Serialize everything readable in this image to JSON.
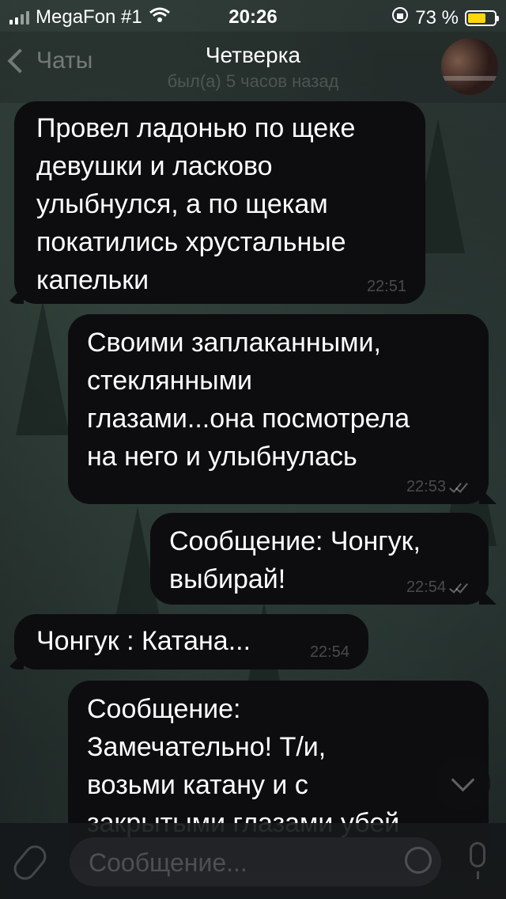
{
  "status_bar": {
    "carrier": "MegaFon #1",
    "time": "20:26",
    "battery_text": "73 %",
    "battery_level": 0.73,
    "battery_color": "#ffd60a"
  },
  "nav": {
    "back_label": "Чаты",
    "title": "Четверка",
    "subtitle": "был(а) 5 часов назад"
  },
  "messages": [
    {
      "direction": "in",
      "text": "Провел ладонью по щеке\nдевушки и ласково\nулыбнулся, а по щекам\nпокатились хрустальные\nкапельки",
      "time": "22:51"
    },
    {
      "direction": "out",
      "text": "Своими заплаканными,\nстеклянными\nглазами...она посмотрела\nна него и улыбнулась",
      "time": "22:53"
    },
    {
      "direction": "out",
      "text": "Сообщение: Чонгук,\nвыбирай!",
      "time": "22:54"
    },
    {
      "direction": "in",
      "text": "Чонгук : Катана...",
      "time": "22:54"
    },
    {
      "direction": "out",
      "text": "Сообщение:\nЗамечательно! Т/и,\nвозьми катану и с\nзакрытыми глазами убей",
      "time": ""
    }
  ],
  "input": {
    "placeholder": "Сообщение..."
  },
  "icons": {
    "signal": "signal-bars-icon",
    "wifi": "wifi-icon",
    "rotation_lock": "rotation-lock-icon",
    "battery": "battery-icon",
    "back": "chevron-left-icon",
    "attach": "paperclip-icon",
    "sticker": "sticker-icon",
    "mic": "microphone-icon",
    "scroll_down": "chevron-down-icon"
  }
}
